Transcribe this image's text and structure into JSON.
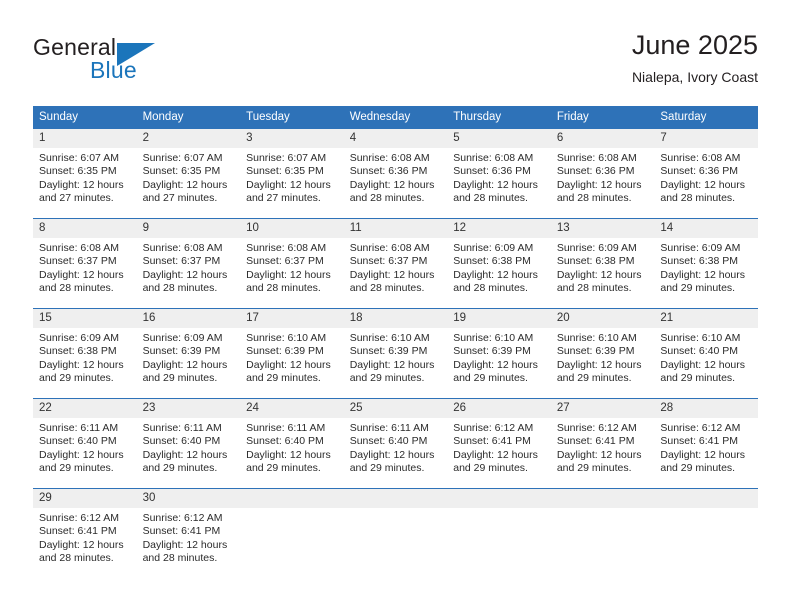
{
  "brand": {
    "name_part1": "General",
    "name_part2": "Blue"
  },
  "header": {
    "month_title": "June 2025",
    "location": "Nialepa, Ivory Coast"
  },
  "calendar": {
    "weekdays": [
      "Sunday",
      "Monday",
      "Tuesday",
      "Wednesday",
      "Thursday",
      "Friday",
      "Saturday"
    ],
    "colors": {
      "header_blue": "#2e72b8",
      "daynum_band": "#efefef",
      "brand_blue": "#1b75bb",
      "text": "#231f20"
    },
    "weeks": [
      [
        {
          "day": "1",
          "sunrise": "Sunrise: 6:07 AM",
          "sunset": "Sunset: 6:35 PM",
          "daylight_line1": "Daylight: 12 hours",
          "daylight_line2": "and 27 minutes."
        },
        {
          "day": "2",
          "sunrise": "Sunrise: 6:07 AM",
          "sunset": "Sunset: 6:35 PM",
          "daylight_line1": "Daylight: 12 hours",
          "daylight_line2": "and 27 minutes."
        },
        {
          "day": "3",
          "sunrise": "Sunrise: 6:07 AM",
          "sunset": "Sunset: 6:35 PM",
          "daylight_line1": "Daylight: 12 hours",
          "daylight_line2": "and 27 minutes."
        },
        {
          "day": "4",
          "sunrise": "Sunrise: 6:08 AM",
          "sunset": "Sunset: 6:36 PM",
          "daylight_line1": "Daylight: 12 hours",
          "daylight_line2": "and 28 minutes."
        },
        {
          "day": "5",
          "sunrise": "Sunrise: 6:08 AM",
          "sunset": "Sunset: 6:36 PM",
          "daylight_line1": "Daylight: 12 hours",
          "daylight_line2": "and 28 minutes."
        },
        {
          "day": "6",
          "sunrise": "Sunrise: 6:08 AM",
          "sunset": "Sunset: 6:36 PM",
          "daylight_line1": "Daylight: 12 hours",
          "daylight_line2": "and 28 minutes."
        },
        {
          "day": "7",
          "sunrise": "Sunrise: 6:08 AM",
          "sunset": "Sunset: 6:36 PM",
          "daylight_line1": "Daylight: 12 hours",
          "daylight_line2": "and 28 minutes."
        }
      ],
      [
        {
          "day": "8",
          "sunrise": "Sunrise: 6:08 AM",
          "sunset": "Sunset: 6:37 PM",
          "daylight_line1": "Daylight: 12 hours",
          "daylight_line2": "and 28 minutes."
        },
        {
          "day": "9",
          "sunrise": "Sunrise: 6:08 AM",
          "sunset": "Sunset: 6:37 PM",
          "daylight_line1": "Daylight: 12 hours",
          "daylight_line2": "and 28 minutes."
        },
        {
          "day": "10",
          "sunrise": "Sunrise: 6:08 AM",
          "sunset": "Sunset: 6:37 PM",
          "daylight_line1": "Daylight: 12 hours",
          "daylight_line2": "and 28 minutes."
        },
        {
          "day": "11",
          "sunrise": "Sunrise: 6:08 AM",
          "sunset": "Sunset: 6:37 PM",
          "daylight_line1": "Daylight: 12 hours",
          "daylight_line2": "and 28 minutes."
        },
        {
          "day": "12",
          "sunrise": "Sunrise: 6:09 AM",
          "sunset": "Sunset: 6:38 PM",
          "daylight_line1": "Daylight: 12 hours",
          "daylight_line2": "and 28 minutes."
        },
        {
          "day": "13",
          "sunrise": "Sunrise: 6:09 AM",
          "sunset": "Sunset: 6:38 PM",
          "daylight_line1": "Daylight: 12 hours",
          "daylight_line2": "and 28 minutes."
        },
        {
          "day": "14",
          "sunrise": "Sunrise: 6:09 AM",
          "sunset": "Sunset: 6:38 PM",
          "daylight_line1": "Daylight: 12 hours",
          "daylight_line2": "and 29 minutes."
        }
      ],
      [
        {
          "day": "15",
          "sunrise": "Sunrise: 6:09 AM",
          "sunset": "Sunset: 6:38 PM",
          "daylight_line1": "Daylight: 12 hours",
          "daylight_line2": "and 29 minutes."
        },
        {
          "day": "16",
          "sunrise": "Sunrise: 6:09 AM",
          "sunset": "Sunset: 6:39 PM",
          "daylight_line1": "Daylight: 12 hours",
          "daylight_line2": "and 29 minutes."
        },
        {
          "day": "17",
          "sunrise": "Sunrise: 6:10 AM",
          "sunset": "Sunset: 6:39 PM",
          "daylight_line1": "Daylight: 12 hours",
          "daylight_line2": "and 29 minutes."
        },
        {
          "day": "18",
          "sunrise": "Sunrise: 6:10 AM",
          "sunset": "Sunset: 6:39 PM",
          "daylight_line1": "Daylight: 12 hours",
          "daylight_line2": "and 29 minutes."
        },
        {
          "day": "19",
          "sunrise": "Sunrise: 6:10 AM",
          "sunset": "Sunset: 6:39 PM",
          "daylight_line1": "Daylight: 12 hours",
          "daylight_line2": "and 29 minutes."
        },
        {
          "day": "20",
          "sunrise": "Sunrise: 6:10 AM",
          "sunset": "Sunset: 6:39 PM",
          "daylight_line1": "Daylight: 12 hours",
          "daylight_line2": "and 29 minutes."
        },
        {
          "day": "21",
          "sunrise": "Sunrise: 6:10 AM",
          "sunset": "Sunset: 6:40 PM",
          "daylight_line1": "Daylight: 12 hours",
          "daylight_line2": "and 29 minutes."
        }
      ],
      [
        {
          "day": "22",
          "sunrise": "Sunrise: 6:11 AM",
          "sunset": "Sunset: 6:40 PM",
          "daylight_line1": "Daylight: 12 hours",
          "daylight_line2": "and 29 minutes."
        },
        {
          "day": "23",
          "sunrise": "Sunrise: 6:11 AM",
          "sunset": "Sunset: 6:40 PM",
          "daylight_line1": "Daylight: 12 hours",
          "daylight_line2": "and 29 minutes."
        },
        {
          "day": "24",
          "sunrise": "Sunrise: 6:11 AM",
          "sunset": "Sunset: 6:40 PM",
          "daylight_line1": "Daylight: 12 hours",
          "daylight_line2": "and 29 minutes."
        },
        {
          "day": "25",
          "sunrise": "Sunrise: 6:11 AM",
          "sunset": "Sunset: 6:40 PM",
          "daylight_line1": "Daylight: 12 hours",
          "daylight_line2": "and 29 minutes."
        },
        {
          "day": "26",
          "sunrise": "Sunrise: 6:12 AM",
          "sunset": "Sunset: 6:41 PM",
          "daylight_line1": "Daylight: 12 hours",
          "daylight_line2": "and 29 minutes."
        },
        {
          "day": "27",
          "sunrise": "Sunrise: 6:12 AM",
          "sunset": "Sunset: 6:41 PM",
          "daylight_line1": "Daylight: 12 hours",
          "daylight_line2": "and 29 minutes."
        },
        {
          "day": "28",
          "sunrise": "Sunrise: 6:12 AM",
          "sunset": "Sunset: 6:41 PM",
          "daylight_line1": "Daylight: 12 hours",
          "daylight_line2": "and 29 minutes."
        }
      ],
      [
        {
          "day": "29",
          "sunrise": "Sunrise: 6:12 AM",
          "sunset": "Sunset: 6:41 PM",
          "daylight_line1": "Daylight: 12 hours",
          "daylight_line2": "and 28 minutes."
        },
        {
          "day": "30",
          "sunrise": "Sunrise: 6:12 AM",
          "sunset": "Sunset: 6:41 PM",
          "daylight_line1": "Daylight: 12 hours",
          "daylight_line2": "and 28 minutes."
        },
        {
          "day": "",
          "sunrise": "",
          "sunset": "",
          "daylight_line1": "",
          "daylight_line2": ""
        },
        {
          "day": "",
          "sunrise": "",
          "sunset": "",
          "daylight_line1": "",
          "daylight_line2": ""
        },
        {
          "day": "",
          "sunrise": "",
          "sunset": "",
          "daylight_line1": "",
          "daylight_line2": ""
        },
        {
          "day": "",
          "sunrise": "",
          "sunset": "",
          "daylight_line1": "",
          "daylight_line2": ""
        },
        {
          "day": "",
          "sunrise": "",
          "sunset": "",
          "daylight_line1": "",
          "daylight_line2": ""
        }
      ]
    ]
  }
}
